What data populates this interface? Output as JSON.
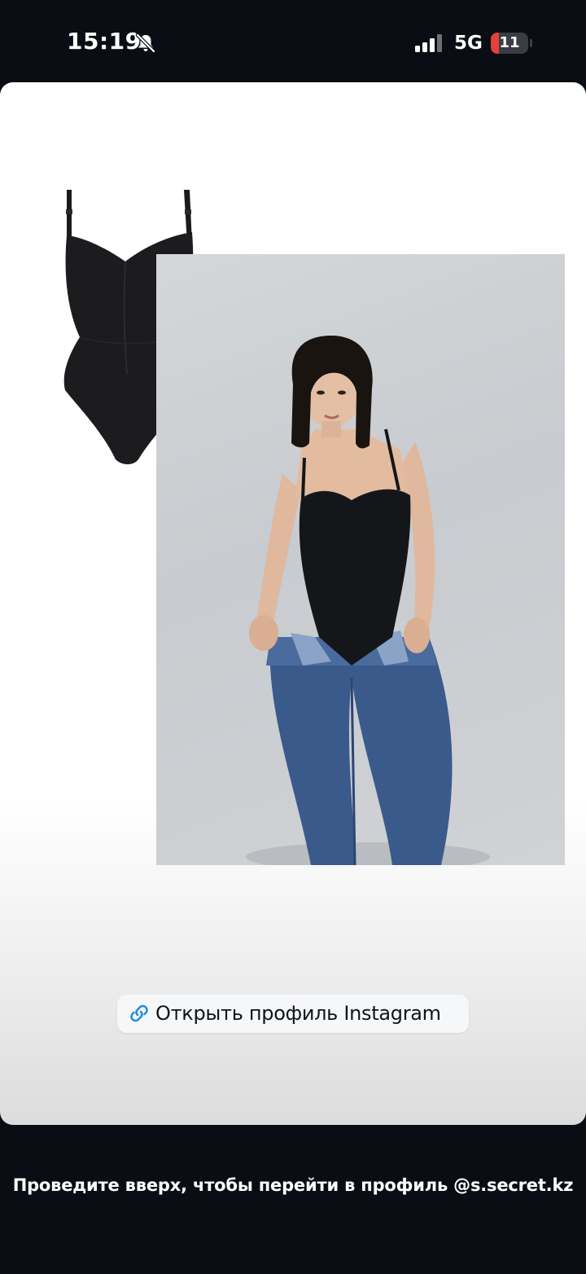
{
  "status_bar": {
    "time": "15:19",
    "network": "5G",
    "battery_level": "11",
    "battery_fraction": 0.11,
    "icons": [
      "bell-slash-icon",
      "signal-icon"
    ]
  },
  "story": {
    "link_sticker": {
      "label": "Открыть профиль Instagram",
      "icon": "link-icon"
    }
  },
  "footer": {
    "swipe_hint": "Проведите вверх, чтобы перейти в профиль @s.secret.kz"
  },
  "colors": {
    "background": "#0a0e14",
    "link_icon": "#1f8ee6",
    "battery_low": "#e5403a"
  }
}
